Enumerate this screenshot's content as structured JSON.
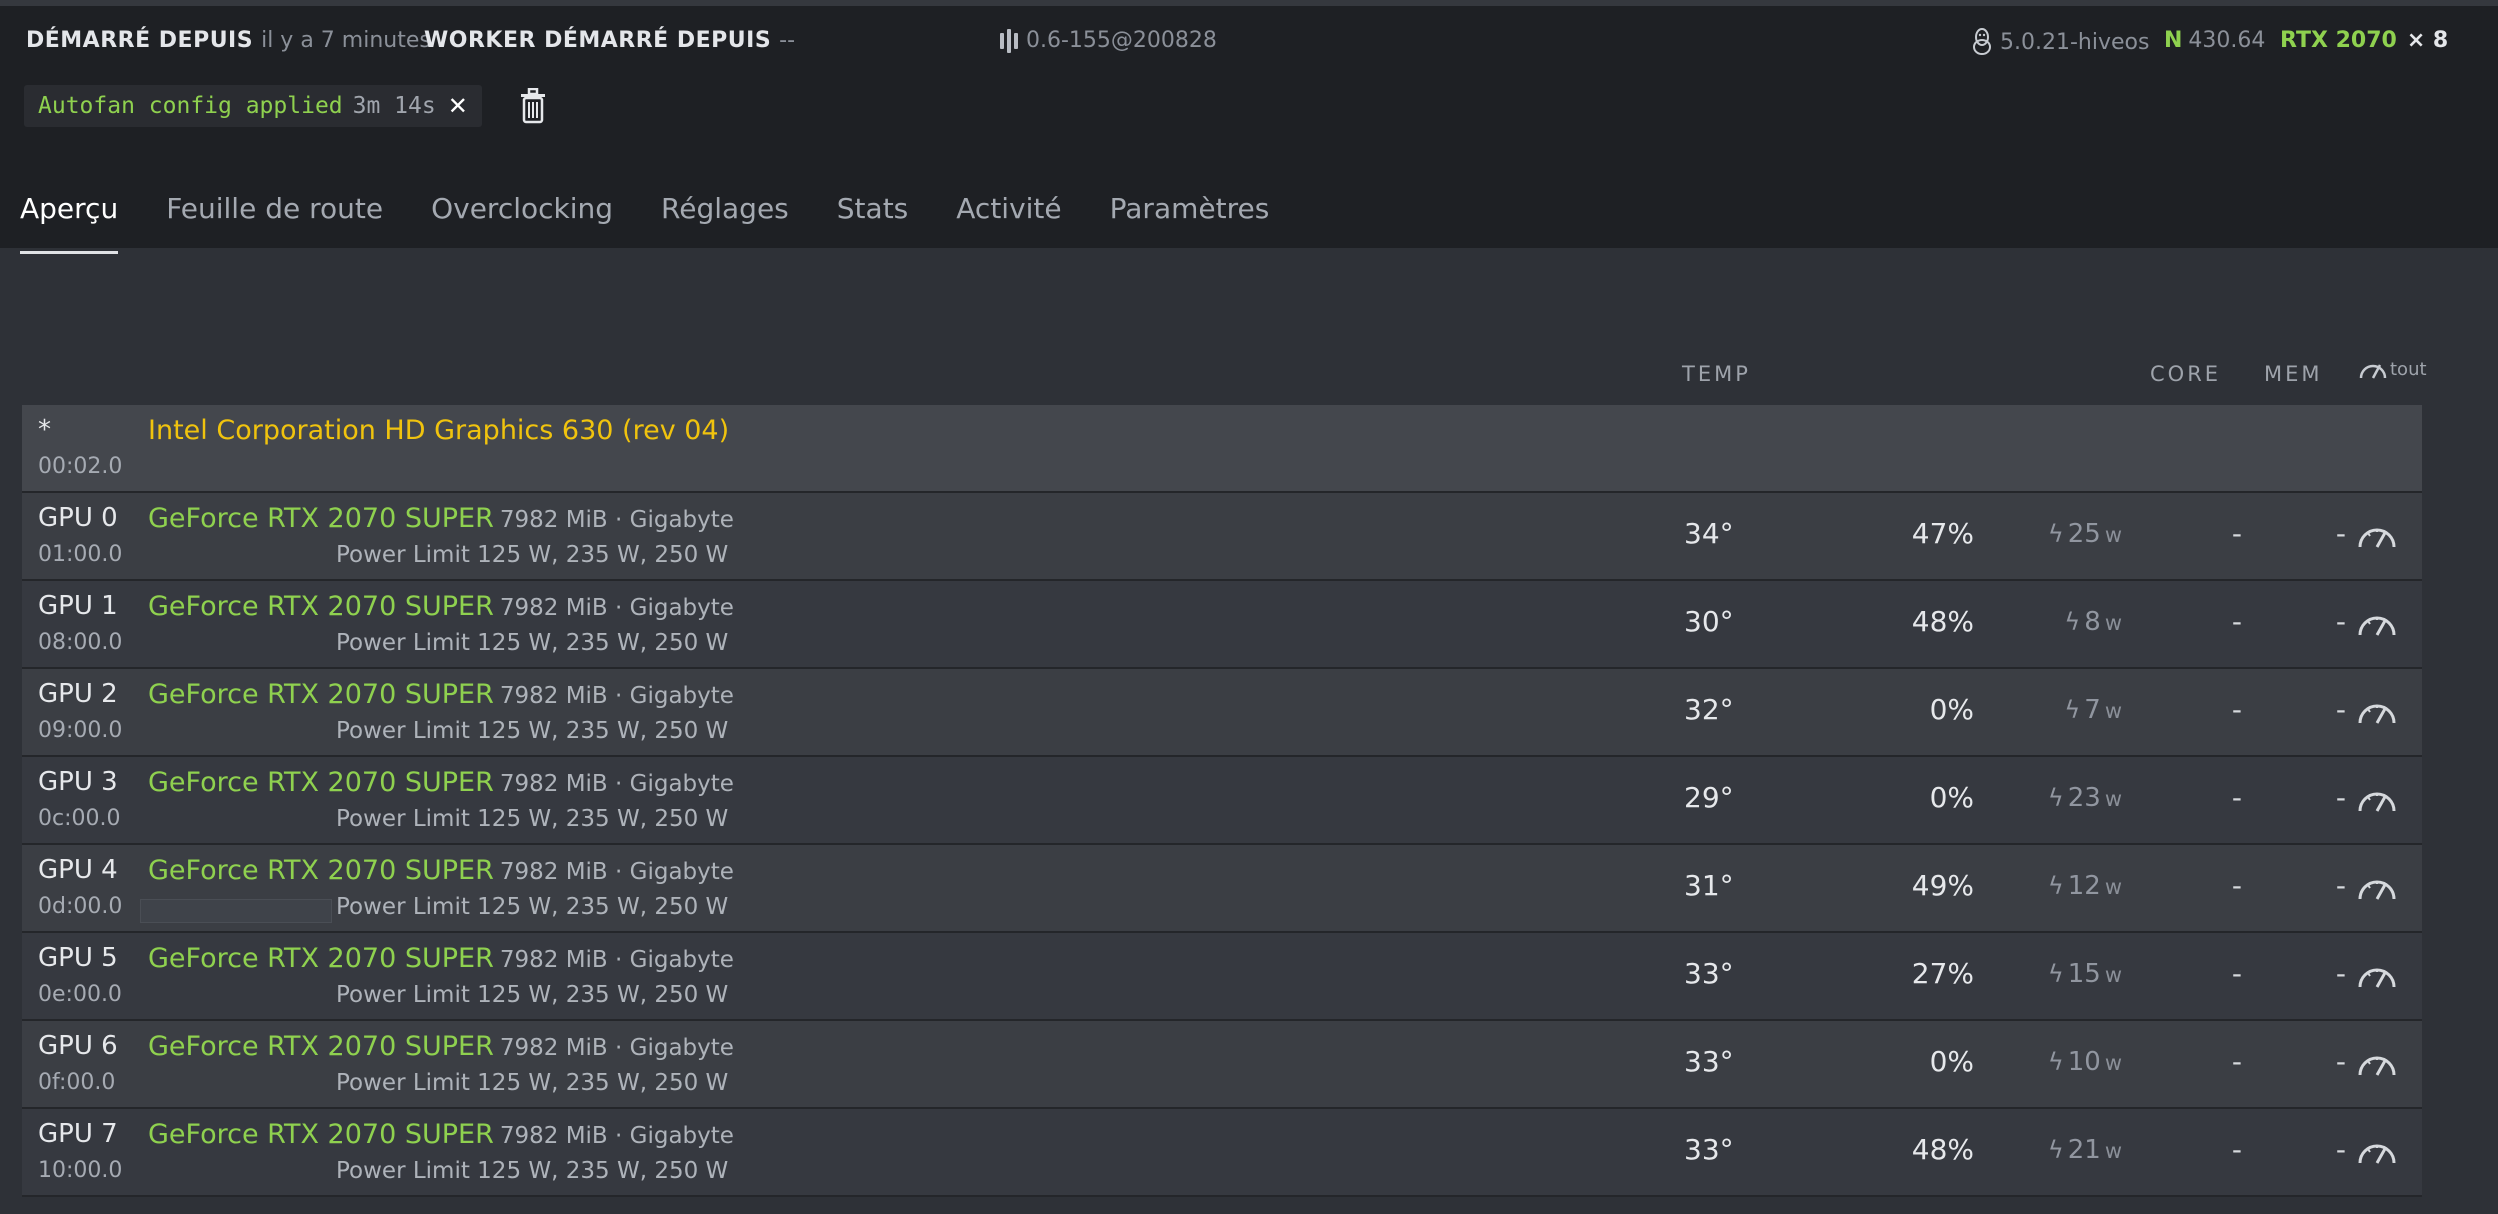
{
  "header": {
    "started_label": "DÉMARRÉ DEPUIS",
    "started_value": "il y a 7 minutes",
    "worker_label": "WORKER DÉMARRÉ DEPUIS",
    "worker_value": "--",
    "version": "0.6-155@200828",
    "kernel": "5.0.21-hiveos",
    "nvidia_prefix": "N",
    "nvidia_version": "430.64",
    "gpu_model": "RTX 2070",
    "gpu_count": "× 8"
  },
  "notification": {
    "text": "Autofan config applied",
    "time": "3m 14s",
    "close": "✕"
  },
  "tabs": [
    "Aperçu",
    "Feuille de route",
    "Overclocking",
    "Réglages",
    "Stats",
    "Activité",
    "Paramètres"
  ],
  "columns": {
    "temp": "TEMP",
    "core": "CORE",
    "mem": "MEM",
    "all": "tout"
  },
  "cpu_row": {
    "id": "*",
    "bus": "00:02.0",
    "name": "Intel Corporation HD Graphics 630 (rev 04)"
  },
  "gpus": [
    {
      "id": "GPU 0",
      "bus": "01:00.0",
      "model": "GeForce RTX 2070 SUPER",
      "meta": "7982 MiB · Gigabyte",
      "power": "Power Limit 125 W, 235 W, 250 W",
      "temp": "34°",
      "fan": "47%",
      "watt": "25",
      "unit": "w",
      "core": "-",
      "mem": "-"
    },
    {
      "id": "GPU 1",
      "bus": "08:00.0",
      "model": "GeForce RTX 2070 SUPER",
      "meta": "7982 MiB · Gigabyte",
      "power": "Power Limit 125 W, 235 W, 250 W",
      "temp": "30°",
      "fan": "48%",
      "watt": "8",
      "unit": "w",
      "core": "-",
      "mem": "-"
    },
    {
      "id": "GPU 2",
      "bus": "09:00.0",
      "model": "GeForce RTX 2070 SUPER",
      "meta": "7982 MiB · Gigabyte",
      "power": "Power Limit 125 W, 235 W, 250 W",
      "temp": "32°",
      "fan": "0%",
      "watt": "7",
      "unit": "w",
      "core": "-",
      "mem": "-"
    },
    {
      "id": "GPU 3",
      "bus": "0c:00.0",
      "model": "GeForce RTX 2070 SUPER",
      "meta": "7982 MiB · Gigabyte",
      "power": "Power Limit 125 W, 235 W, 250 W",
      "temp": "29°",
      "fan": "0%",
      "watt": "23",
      "unit": "w",
      "core": "-",
      "mem": "-"
    },
    {
      "id": "GPU 4",
      "bus": "0d:00.0",
      "model": "GeForce RTX 2070 SUPER",
      "meta": "7982 MiB · Gigabyte",
      "power": "Power Limit 125 W, 235 W, 250 W",
      "temp": "31°",
      "fan": "49%",
      "watt": "12",
      "unit": "w",
      "core": "-",
      "mem": "-"
    },
    {
      "id": "GPU 5",
      "bus": "0e:00.0",
      "model": "GeForce RTX 2070 SUPER",
      "meta": "7982 MiB · Gigabyte",
      "power": "Power Limit 125 W, 235 W, 250 W",
      "temp": "33°",
      "fan": "27%",
      "watt": "15",
      "unit": "w",
      "core": "-",
      "mem": "-"
    },
    {
      "id": "GPU 6",
      "bus": "0f:00.0",
      "model": "GeForce RTX 2070 SUPER",
      "meta": "7982 MiB · Gigabyte",
      "power": "Power Limit 125 W, 235 W, 250 W",
      "temp": "33°",
      "fan": "0%",
      "watt": "10",
      "unit": "w",
      "core": "-",
      "mem": "-"
    },
    {
      "id": "GPU 7",
      "bus": "10:00.0",
      "model": "GeForce RTX 2070 SUPER",
      "meta": "7982 MiB · Gigabyte",
      "power": "Power Limit 125 W, 235 W, 250 W",
      "temp": "33°",
      "fan": "48%",
      "watt": "21",
      "unit": "w",
      "core": "-",
      "mem": "-"
    }
  ],
  "colors": {
    "accent_green": "#8fd14f",
    "cpu_yellow": "#f0c30e",
    "header_bg": "#1e2024"
  }
}
